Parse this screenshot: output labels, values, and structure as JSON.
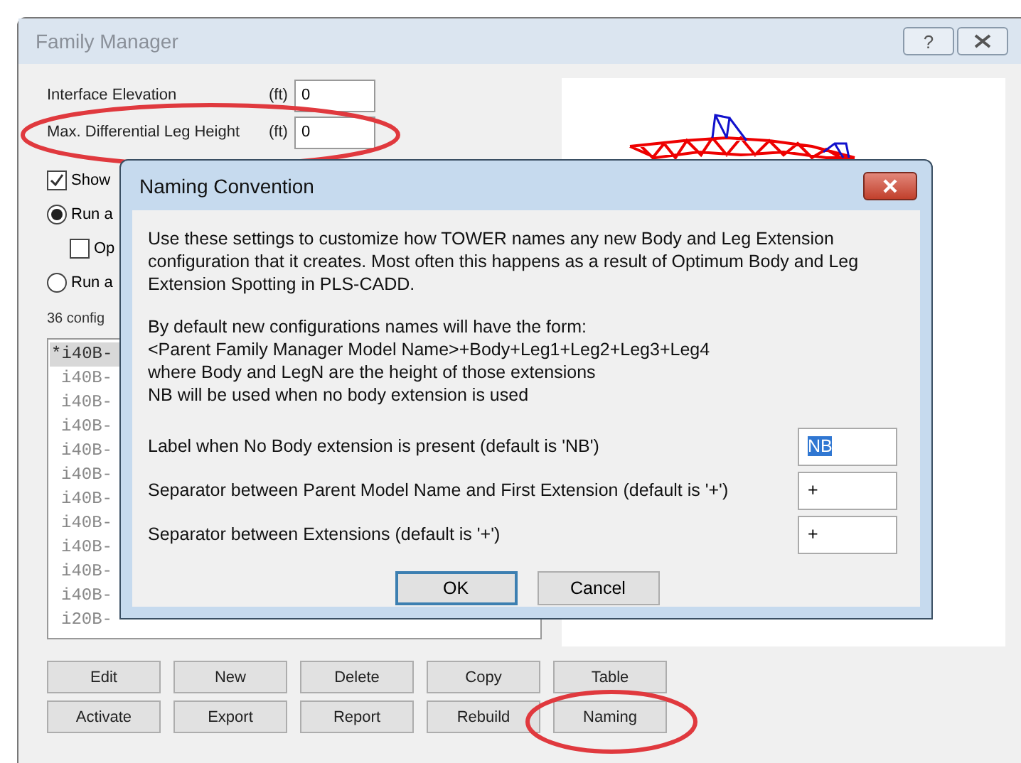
{
  "window": {
    "title": "Family Manager",
    "help": "?"
  },
  "fields": [
    {
      "label": "Interface Elevation",
      "unit": "(ft)",
      "value": "0"
    },
    {
      "label": "Max. Differential Leg Height",
      "unit": "(ft)",
      "value": "0"
    }
  ],
  "options": [
    {
      "kind": "checkbox",
      "label": "Show",
      "checked": true
    },
    {
      "kind": "radio",
      "label": "Run a",
      "selected": true,
      "children": [
        {
          "kind": "checkbox",
          "label": "Op",
          "checked": false
        }
      ]
    },
    {
      "kind": "radio",
      "label": "Run a",
      "selected": false
    }
  ],
  "config_count": "36 config",
  "configurations": [
    {
      "name": "*i40B-",
      "selected": true
    },
    {
      "name": "i40B-",
      "selected": false
    },
    {
      "name": "i40B-",
      "selected": false
    },
    {
      "name": "i40B-",
      "selected": false
    },
    {
      "name": "i40B-",
      "selected": false
    },
    {
      "name": "i40B-",
      "selected": false
    },
    {
      "name": "i40B-",
      "selected": false
    },
    {
      "name": "i40B-",
      "selected": false
    },
    {
      "name": "i40B-",
      "selected": false
    },
    {
      "name": "i40B-",
      "selected": false
    },
    {
      "name": "i40B-",
      "selected": false
    },
    {
      "name": "i20B-",
      "selected": false
    }
  ],
  "button_rows": [
    [
      "Edit",
      "New",
      "Delete",
      "Copy",
      "Table"
    ],
    [
      "Activate",
      "Export",
      "Report",
      "Rebuild",
      "Naming"
    ]
  ],
  "dialog": {
    "title": "Naming Convention",
    "paragraphs": [
      "Use these settings to customize how TOWER names any new Body and Leg Extension\nconfiguration that it creates.  Most often this happens as a result of Optimum Body and Leg\nExtension Spotting in PLS-CADD.",
      "By default new configurations names will have the form:\n<Parent Family Manager Model Name>+Body+Leg1+Leg2+Leg3+Leg4\nwhere Body and LegN are the height of those extensions\nNB will be used when no body extension is used"
    ],
    "settings": [
      {
        "label": "Label when No Body extension is present (default is 'NB')",
        "value": "NB",
        "selected": true
      },
      {
        "label": "Separator between Parent Model Name and First Extension (default is '+')",
        "value": "+",
        "selected": false
      },
      {
        "label": "Separator between Extensions (default is '+')",
        "value": "+",
        "selected": false
      }
    ],
    "buttons": [
      {
        "label": "OK",
        "default": true
      },
      {
        "label": "Cancel",
        "default": false
      }
    ]
  }
}
